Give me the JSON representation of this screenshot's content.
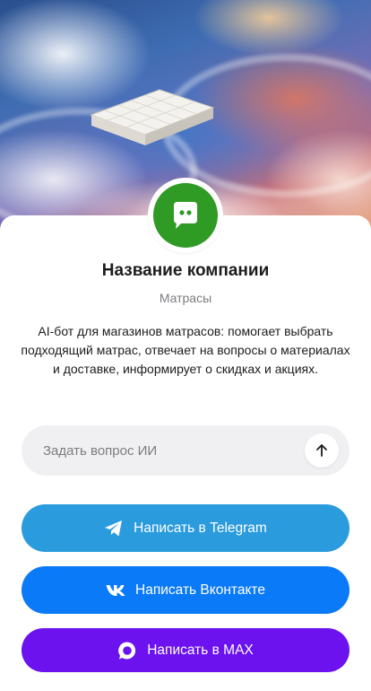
{
  "hero": {
    "image": "mattress-in-clouds"
  },
  "avatar": {
    "icon": "chat-bot-icon",
    "bg_color": "#2f9a24"
  },
  "company": {
    "name": "Название компании",
    "category": "Матрасы",
    "description": "AI-бот для магазинов матрасов: помогает выбрать подходящий матрас, отвечает на вопросы о материалах и доставке, информирует о скидках и акциях."
  },
  "ask": {
    "placeholder": "Задать вопрос ИИ",
    "send_icon": "arrow-up-icon"
  },
  "buttons": {
    "telegram": {
      "label": "Написать в Telegram",
      "icon": "telegram-icon",
      "color": "#2a9bdd"
    },
    "vk": {
      "label": "Написать Вконтакте",
      "icon": "vk-icon",
      "color": "#0a7af8"
    },
    "max": {
      "label": "Написать в MAX",
      "icon": "max-icon",
      "color": "#6b12ee"
    }
  }
}
